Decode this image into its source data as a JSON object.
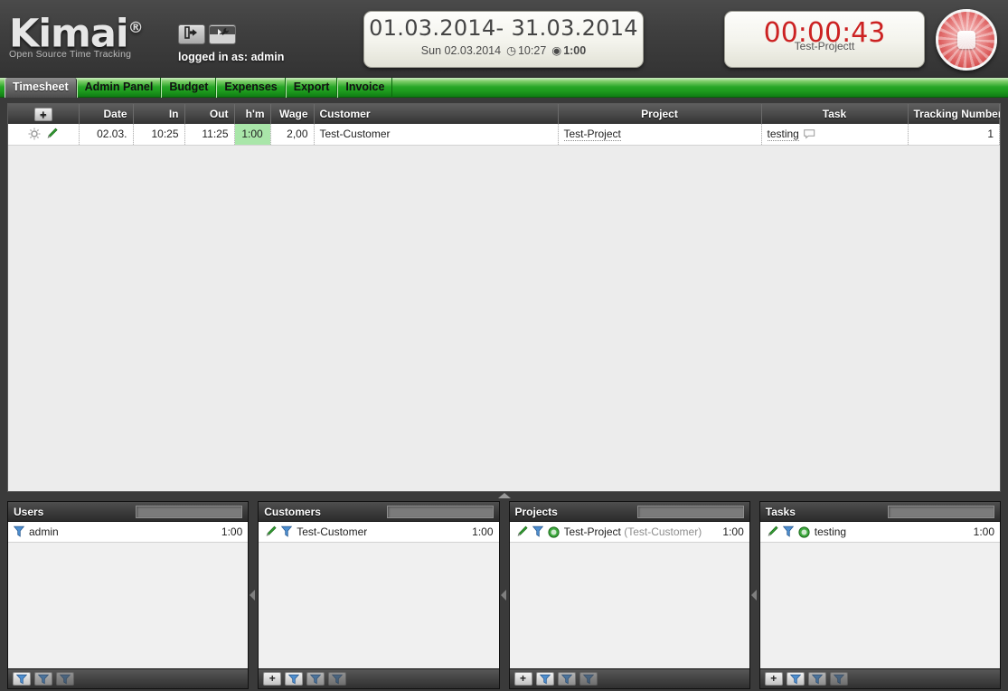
{
  "app": {
    "logo_name": "Kimai",
    "logo_reg": "®",
    "tagline": "Open Source Time Tracking"
  },
  "header": {
    "logout_icon": "logout-icon",
    "settings_icon": "wrench-icon",
    "logged_in_prefix": "logged in as:",
    "logged_in_user": "admin",
    "date_range": "01.03.2014-  31.03.2014",
    "current_day": "Sun 02.03.2014",
    "clock_icon": "◷",
    "current_time": "10:27",
    "eye_icon": "◉",
    "visible_total": "1:00",
    "timer_value": "00:00:43",
    "timer_project": "Test-Projectt",
    "record_button_icon": "stop-record-icon"
  },
  "tabs": [
    {
      "label": "Timesheet",
      "active": true
    },
    {
      "label": "Admin Panel",
      "active": false
    },
    {
      "label": "Budget",
      "active": false
    },
    {
      "label": "Expenses",
      "active": false
    },
    {
      "label": "Export",
      "active": false
    },
    {
      "label": "Invoice",
      "active": false
    }
  ],
  "timesheet": {
    "add_button_label": "+",
    "columns": [
      "Date",
      "In",
      "Out",
      "h'm",
      "Wage",
      "Customer",
      "Project",
      "Task",
      "Tracking Number"
    ],
    "rows": [
      {
        "date": "02.03.",
        "in": "10:25",
        "out": "11:25",
        "hm": "1:00",
        "wage": "2,00",
        "customer": "Test-Customer",
        "project": "Test-Project",
        "task": "testing",
        "tracking_number": "1"
      }
    ]
  },
  "panels": [
    {
      "title": "Users",
      "search_value": "",
      "rows": [
        {
          "icons": [
            "funnel-icon"
          ],
          "name": "admin",
          "sub": "",
          "time": "1:00"
        }
      ],
      "footer": [
        "filter-icon-1",
        "filter-icon-2",
        "filter-icon-3"
      ],
      "has_add": false
    },
    {
      "title": "Customers",
      "search_value": "",
      "rows": [
        {
          "icons": [
            "pencil-icon",
            "funnel-icon"
          ],
          "name": "Test-Customer",
          "sub": "",
          "time": "1:00"
        }
      ],
      "footer": [
        "filter-icon-1",
        "filter-icon-2",
        "filter-icon-3"
      ],
      "has_add": true,
      "add_label": "+"
    },
    {
      "title": "Projects",
      "search_value": "",
      "rows": [
        {
          "icons": [
            "pencil-icon",
            "funnel-icon",
            "play-icon"
          ],
          "name": "Test-Project",
          "sub": "(Test-Customer)",
          "time": "1:00"
        }
      ],
      "footer": [
        "filter-icon-1",
        "filter-icon-2",
        "filter-icon-3"
      ],
      "has_add": true,
      "add_label": "+"
    },
    {
      "title": "Tasks",
      "search_value": "",
      "rows": [
        {
          "icons": [
            "pencil-icon",
            "funnel-icon",
            "play-icon"
          ],
          "name": "testing",
          "sub": "",
          "time": "1:00"
        }
      ],
      "footer": [
        "filter-icon-1",
        "filter-icon-2",
        "filter-icon-3"
      ],
      "has_add": true,
      "add_label": "+"
    }
  ],
  "colors": {
    "accent_green": "#27a627",
    "timer_red": "#cc2222",
    "hm_highlight": "#a9e6a9",
    "chrome_dark": "#3a3a3a"
  }
}
